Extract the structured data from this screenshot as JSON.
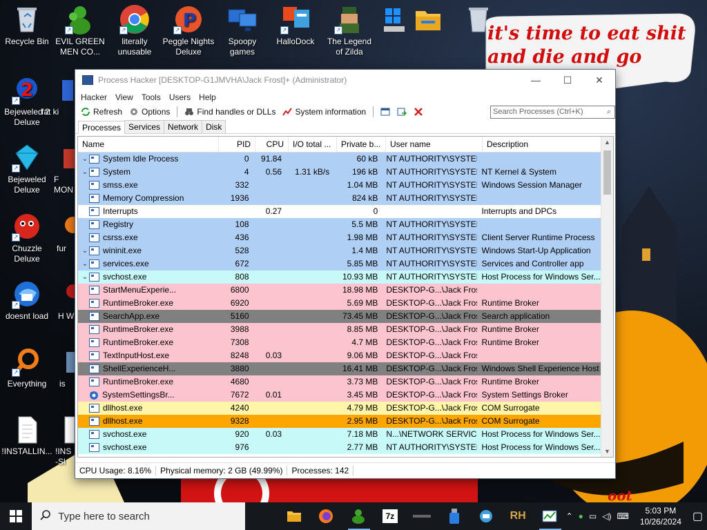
{
  "desktop": {
    "icons": [
      {
        "label": "Recycle Bin",
        "icon": "recycle-bin-icon"
      },
      {
        "label": "EVIL GREEN MEN CO...",
        "icon": "green-men-icon"
      },
      {
        "label": "literally unusable",
        "icon": "chrome-icon"
      },
      {
        "label": "Peggle Nights Deluxe",
        "icon": "peggle-icon"
      },
      {
        "label": "Spoopy games",
        "icon": "folder-computers-icon"
      },
      {
        "label": "HalloDock",
        "icon": "hallodock-icon"
      },
      {
        "label": "The Legend of Zilda",
        "icon": "zilda-icon"
      },
      {
        "label": "Bejeweled 2 Deluxe",
        "icon": "bejeweled2-icon"
      },
      {
        "label": "fat ki",
        "icon": "partial-icon"
      },
      {
        "label": "Bejeweled Deluxe",
        "icon": "bejeweled-icon"
      },
      {
        "label": "F MON",
        "icon": "partial-icon"
      },
      {
        "label": "Chuzzle Deluxe",
        "icon": "chuzzle-icon"
      },
      {
        "label": "fur",
        "icon": "partial-icon"
      },
      {
        "label": "doesnt load",
        "icon": "thunderbird-icon"
      },
      {
        "label": "H W",
        "icon": "partial-icon"
      },
      {
        "label": "Everything",
        "icon": "everything-icon"
      },
      {
        "label": "is",
        "icon": "partial-icon"
      },
      {
        "label": "!INSTALLIN...",
        "icon": "document-icon"
      },
      {
        "label": "!INS -Sl",
        "icon": "partial-icon"
      }
    ],
    "overlay_text": "it's time to eat shit and die and go trick vote!",
    "corner_tag": "oot"
  },
  "window": {
    "title": "Process Hacker [DESKTOP-G1JMVHA\\Jack Frost]+ (Administrator)",
    "controls": {
      "minimize": "—",
      "maximize": "☐",
      "close": "✕"
    },
    "menu": [
      "Hacker",
      "View",
      "Tools",
      "Users",
      "Help"
    ],
    "toolbar": {
      "refresh": "Refresh",
      "options": "Options",
      "find_handles": "Find handles or DLLs",
      "system_info": "System information"
    },
    "search_placeholder": "Search Processes (Ctrl+K)",
    "tabs": [
      "Processes",
      "Services",
      "Network",
      "Disk"
    ],
    "active_tab": "Processes",
    "columns": [
      "Name",
      "PID",
      "CPU",
      "I/O total ...",
      "Private b...",
      "User name",
      "Description"
    ],
    "rows": [
      {
        "depth": 0,
        "exp": "v",
        "name": "System Idle Process",
        "pid": "0",
        "cpu": "91.84",
        "io": "",
        "priv": "60 kB",
        "user": "NT AUTHORITY\\SYSTEM",
        "desc": "",
        "bg": "#b0cff5"
      },
      {
        "depth": 1,
        "exp": "v",
        "name": "System",
        "pid": "4",
        "cpu": "0.56",
        "io": "1.31 kB/s",
        "priv": "196 kB",
        "user": "NT AUTHORITY\\SYSTEM",
        "desc": "NT Kernel & System",
        "bg": "#b0cff5"
      },
      {
        "depth": 2,
        "exp": "",
        "name": "smss.exe",
        "pid": "332",
        "cpu": "",
        "io": "",
        "priv": "1.04 MB",
        "user": "NT AUTHORITY\\SYSTEM",
        "desc": "Windows Session Manager",
        "bg": "#b0cff5"
      },
      {
        "depth": 2,
        "exp": "",
        "name": "Memory Compression",
        "pid": "1936",
        "cpu": "",
        "io": "",
        "priv": "824 kB",
        "user": "NT AUTHORITY\\SYSTEM",
        "desc": "",
        "bg": "#b0cff5"
      },
      {
        "depth": 1,
        "exp": "",
        "name": "Interrupts",
        "pid": "",
        "cpu": "0.27",
        "io": "",
        "priv": "0",
        "user": "",
        "desc": "Interrupts and DPCs",
        "bg": "#ffffff"
      },
      {
        "depth": 0,
        "exp": "",
        "name": "Registry",
        "pid": "108",
        "cpu": "",
        "io": "",
        "priv": "5.5 MB",
        "user": "NT AUTHORITY\\SYSTEM",
        "desc": "",
        "bg": "#b0cff5"
      },
      {
        "depth": 0,
        "exp": "",
        "name": "csrss.exe",
        "pid": "436",
        "cpu": "",
        "io": "",
        "priv": "1.98 MB",
        "user": "NT AUTHORITY\\SYSTEM",
        "desc": "Client Server Runtime Process",
        "bg": "#b0cff5"
      },
      {
        "depth": 0,
        "exp": "v",
        "name": "wininit.exe",
        "pid": "528",
        "cpu": "",
        "io": "",
        "priv": "1.4 MB",
        "user": "NT AUTHORITY\\SYSTEM",
        "desc": "Windows Start-Up Application",
        "bg": "#b0cff5"
      },
      {
        "depth": 1,
        "exp": "v",
        "name": "services.exe",
        "pid": "672",
        "cpu": "",
        "io": "",
        "priv": "5.85 MB",
        "user": "NT AUTHORITY\\SYSTEM",
        "desc": "Services and Controller app",
        "bg": "#b0cff5"
      },
      {
        "depth": 2,
        "exp": "v",
        "name": "svchost.exe",
        "pid": "808",
        "cpu": "",
        "io": "",
        "priv": "10.93 MB",
        "user": "NT AUTHORITY\\SYSTEM",
        "desc": "Host Process for Windows Ser...",
        "bg": "#c6f9f7"
      },
      {
        "depth": 3,
        "exp": "",
        "name": "StartMenuExperie...",
        "pid": "6800",
        "cpu": "",
        "io": "",
        "priv": "18.98 MB",
        "user": "DESKTOP-G...\\Jack Frost",
        "desc": "",
        "bg": "#fcc4cf"
      },
      {
        "depth": 3,
        "exp": "",
        "name": "RuntimeBroker.exe",
        "pid": "6920",
        "cpu": "",
        "io": "",
        "priv": "5.69 MB",
        "user": "DESKTOP-G...\\Jack Frost",
        "desc": "Runtime Broker",
        "bg": "#fcc4cf"
      },
      {
        "depth": 3,
        "exp": "",
        "name": "SearchApp.exe",
        "pid": "5160",
        "cpu": "",
        "io": "",
        "priv": "73.45 MB",
        "user": "DESKTOP-G...\\Jack Frost",
        "desc": "Search application",
        "bg": "#808080"
      },
      {
        "depth": 3,
        "exp": "",
        "name": "RuntimeBroker.exe",
        "pid": "3988",
        "cpu": "",
        "io": "",
        "priv": "8.85 MB",
        "user": "DESKTOP-G...\\Jack Frost",
        "desc": "Runtime Broker",
        "bg": "#fcc4cf"
      },
      {
        "depth": 3,
        "exp": "",
        "name": "RuntimeBroker.exe",
        "pid": "7308",
        "cpu": "",
        "io": "",
        "priv": "4.7 MB",
        "user": "DESKTOP-G...\\Jack Frost",
        "desc": "Runtime Broker",
        "bg": "#fcc4cf"
      },
      {
        "depth": 3,
        "exp": "",
        "name": "TextInputHost.exe",
        "pid": "8248",
        "cpu": "0.03",
        "io": "",
        "priv": "9.06 MB",
        "user": "DESKTOP-G...\\Jack Frost",
        "desc": "",
        "bg": "#fcc4cf"
      },
      {
        "depth": 3,
        "exp": "",
        "name": "ShellExperienceH...",
        "pid": "3880",
        "cpu": "",
        "io": "",
        "priv": "16.41 MB",
        "user": "DESKTOP-G...\\Jack Frost",
        "desc": "Windows Shell Experience Host",
        "bg": "#808080"
      },
      {
        "depth": 3,
        "exp": "",
        "name": "RuntimeBroker.exe",
        "pid": "4680",
        "cpu": "",
        "io": "",
        "priv": "3.73 MB",
        "user": "DESKTOP-G...\\Jack Frost",
        "desc": "Runtime Broker",
        "bg": "#fcc4cf"
      },
      {
        "depth": 3,
        "exp": "",
        "name": "SystemSettingsBr...",
        "pid": "7672",
        "cpu": "0.01",
        "io": "",
        "priv": "3.45 MB",
        "user": "DESKTOP-G...\\Jack Frost",
        "desc": "System Settings Broker",
        "bg": "#fcc4cf",
        "gear": true
      },
      {
        "depth": 3,
        "exp": "",
        "name": "dllhost.exe",
        "pid": "4240",
        "cpu": "",
        "io": "",
        "priv": "4.79 MB",
        "user": "DESKTOP-G...\\Jack Frost",
        "desc": "COM Surrogate",
        "bg": "#fff5a8"
      },
      {
        "depth": 3,
        "exp": "",
        "name": "dllhost.exe",
        "pid": "9328",
        "cpu": "",
        "io": "",
        "priv": "2.95 MB",
        "user": "DESKTOP-G...\\Jack Frost",
        "desc": "COM Surrogate",
        "bg": "#ffa500"
      },
      {
        "depth": 2,
        "exp": "",
        "name": "svchost.exe",
        "pid": "920",
        "cpu": "0.03",
        "io": "",
        "priv": "7.18 MB",
        "user": "N...\\NETWORK SERVICE",
        "desc": "Host Process for Windows Ser...",
        "bg": "#c6f9f7"
      },
      {
        "depth": 2,
        "exp": "",
        "name": "svchost.exe",
        "pid": "976",
        "cpu": "",
        "io": "",
        "priv": "2.77 MB",
        "user": "NT AUTHORITY\\SYSTEM",
        "desc": "Host Process for Windows Ser...",
        "bg": "#c6f9f7"
      }
    ],
    "status": {
      "cpu": "CPU Usage: 8.16%",
      "memory": "Physical memory: 2 GB (49.99%)",
      "processes": "Processes: 142"
    }
  },
  "taskbar": {
    "search_placeholder": "Type here to search",
    "apps": [
      "file-explorer-icon",
      "firefox-icon",
      "green-men-icon",
      "7zip-icon",
      "chain-icon",
      "usb-icon",
      "hallodock-icon",
      "rh-icon",
      "process-hacker-icon"
    ],
    "sevenzip_label": "7z",
    "rh_label": "RH",
    "clock_time": "5:03 PM",
    "clock_date": "10/26/2024"
  }
}
